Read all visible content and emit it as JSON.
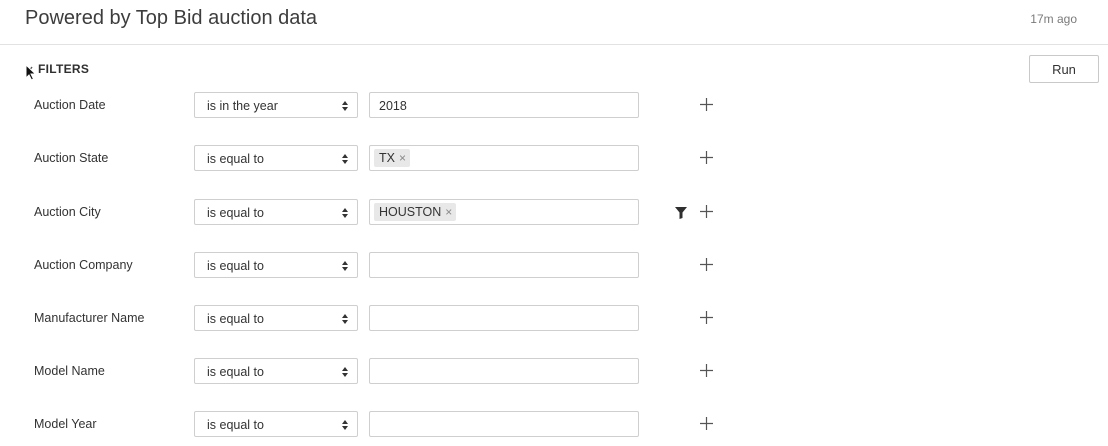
{
  "header": {
    "title": "Powered by Top Bid auction data",
    "timestamp": "17m ago"
  },
  "filters": {
    "label": "FILTERS",
    "run_label": "Run",
    "rows": [
      {
        "label": "Auction Date",
        "operator": "is in the year",
        "value": "2018"
      },
      {
        "label": "Auction State",
        "operator": "is equal to",
        "token": "TX"
      },
      {
        "label": "Auction City",
        "operator": "is equal to",
        "token": "HOUSTON"
      },
      {
        "label": "Auction Company",
        "operator": "is equal to",
        "value": ""
      },
      {
        "label": "Manufacturer Name",
        "operator": "is equal to",
        "value": ""
      },
      {
        "label": "Model Name",
        "operator": "is equal to",
        "value": ""
      },
      {
        "label": "Model Year",
        "operator": "is equal to",
        "value": ""
      }
    ]
  },
  "icons": {
    "caret": "caret-down-icon",
    "add": "plus-icon",
    "funnel": "funnel-icon",
    "select_arrows": "up-down-arrows-icon",
    "token_remove": "×"
  }
}
